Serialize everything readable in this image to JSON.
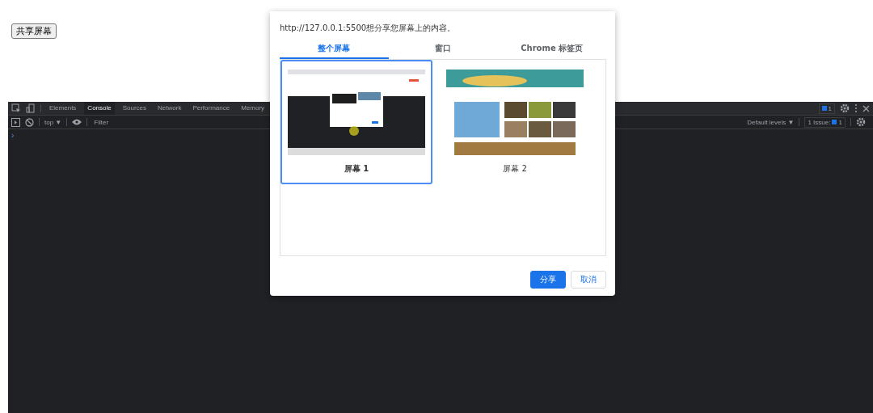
{
  "page_button": "共享屏幕",
  "devtools": {
    "tabs": [
      {
        "label": "Elements",
        "selected": false
      },
      {
        "label": "Console",
        "selected": true
      },
      {
        "label": "Sources",
        "selected": false
      },
      {
        "label": "Network",
        "selected": false
      },
      {
        "label": "Performance",
        "selected": false
      },
      {
        "label": "Memory",
        "selected": false
      }
    ],
    "message_count": "1",
    "context": "top ▼",
    "filter_placeholder": "Filter",
    "levels": "Default levels ▼",
    "issues_label": "1 Issue:",
    "issues_count": "1",
    "prompt": "›"
  },
  "dialog": {
    "message": "http://127.0.0.1:5500想分享您屏幕上的内容。",
    "tabs": [
      {
        "label": "整个屏幕",
        "selected": true
      },
      {
        "label": "窗口",
        "selected": false
      },
      {
        "label": "Chrome 标签页",
        "selected": false
      }
    ],
    "sources": [
      {
        "label": "屏幕 1",
        "selected": true,
        "kind": "picture"
      },
      {
        "label": "屏幕 2",
        "selected": false,
        "kind": "picture"
      }
    ],
    "buttons": [
      {
        "label": "分享",
        "kind": "primary"
      },
      {
        "label": "取消",
        "kind": "secondary"
      }
    ]
  }
}
